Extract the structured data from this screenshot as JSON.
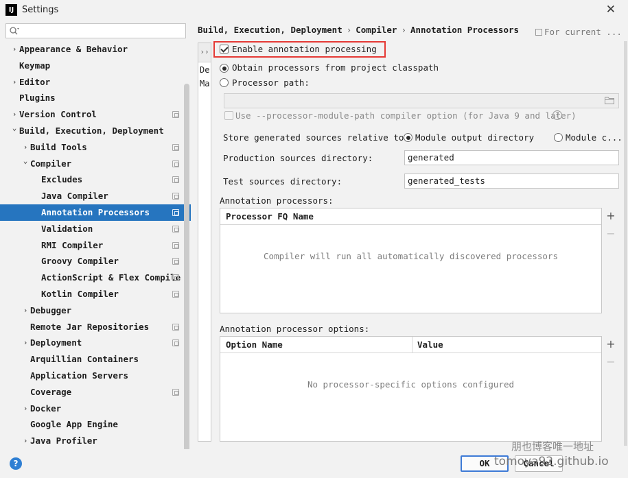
{
  "window": {
    "app_icon_text": "IJ",
    "title": "Settings"
  },
  "search": {
    "placeholder": ""
  },
  "sidebar": {
    "items": [
      {
        "label": "Appearance & Behavior",
        "level": 0,
        "chevron": "right",
        "proj": false,
        "selected": false
      },
      {
        "label": "Keymap",
        "level": 0,
        "chevron": "",
        "proj": false,
        "selected": false
      },
      {
        "label": "Editor",
        "level": 0,
        "chevron": "right",
        "proj": false,
        "selected": false
      },
      {
        "label": "Plugins",
        "level": 0,
        "chevron": "",
        "proj": false,
        "selected": false
      },
      {
        "label": "Version Control",
        "level": 0,
        "chevron": "right",
        "proj": true,
        "selected": false
      },
      {
        "label": "Build, Execution, Deployment",
        "level": 0,
        "chevron": "down",
        "proj": false,
        "selected": false
      },
      {
        "label": "Build Tools",
        "level": 1,
        "chevron": "right",
        "proj": true,
        "selected": false
      },
      {
        "label": "Compiler",
        "level": 1,
        "chevron": "down",
        "proj": true,
        "selected": false
      },
      {
        "label": "Excludes",
        "level": 2,
        "chevron": "",
        "proj": true,
        "selected": false
      },
      {
        "label": "Java Compiler",
        "level": 2,
        "chevron": "",
        "proj": true,
        "selected": false
      },
      {
        "label": "Annotation Processors",
        "level": 2,
        "chevron": "",
        "proj": true,
        "selected": true
      },
      {
        "label": "Validation",
        "level": 2,
        "chevron": "",
        "proj": true,
        "selected": false
      },
      {
        "label": "RMI Compiler",
        "level": 2,
        "chevron": "",
        "proj": true,
        "selected": false
      },
      {
        "label": "Groovy Compiler",
        "level": 2,
        "chevron": "",
        "proj": true,
        "selected": false
      },
      {
        "label": "ActionScript & Flex Compile",
        "level": 2,
        "chevron": "",
        "proj": true,
        "selected": false
      },
      {
        "label": "Kotlin Compiler",
        "level": 2,
        "chevron": "",
        "proj": true,
        "selected": false
      },
      {
        "label": "Debugger",
        "level": 1,
        "chevron": "right",
        "proj": false,
        "selected": false
      },
      {
        "label": "Remote Jar Repositories",
        "level": 1,
        "chevron": "",
        "proj": true,
        "selected": false
      },
      {
        "label": "Deployment",
        "level": 1,
        "chevron": "right",
        "proj": true,
        "selected": false
      },
      {
        "label": "Arquillian Containers",
        "level": 1,
        "chevron": "",
        "proj": false,
        "selected": false
      },
      {
        "label": "Application Servers",
        "level": 1,
        "chevron": "",
        "proj": false,
        "selected": false
      },
      {
        "label": "Coverage",
        "level": 1,
        "chevron": "",
        "proj": true,
        "selected": false
      },
      {
        "label": "Docker",
        "level": 1,
        "chevron": "right",
        "proj": false,
        "selected": false
      },
      {
        "label": "Google App Engine",
        "level": 1,
        "chevron": "",
        "proj": false,
        "selected": false
      },
      {
        "label": "Java Profiler",
        "level": 1,
        "chevron": "right",
        "proj": false,
        "selected": false
      }
    ]
  },
  "breadcrumb": {
    "parts": [
      "Build, Execution, Deployment",
      "Compiler",
      "Annotation Processors"
    ],
    "separator": "›",
    "for_current": "For current ..."
  },
  "profiles": {
    "collapse_glyph": "››",
    "rows": [
      "De",
      "Ma"
    ]
  },
  "form": {
    "enable_label": "Enable annotation processing",
    "enable_checked": true,
    "obtain_label": "Obtain processors from project classpath",
    "processor_path_label": "Processor path:",
    "processor_path_value": "",
    "module_path_label": "Use --processor-module-path compiler option (for Java 9 and later)",
    "help_glyph": "?",
    "store_label": "Store generated sources relative to:",
    "module_output_label": "Module output directory",
    "module_content_label": "Module c...",
    "production_label": "Production sources directory:",
    "production_value": "generated",
    "test_label": "Test sources directory:",
    "test_value": "generated_tests"
  },
  "processors_table": {
    "section_label": "Annotation processors:",
    "column": "Processor FQ Name",
    "empty_message": "Compiler will run all automatically discovered processors",
    "add": "+",
    "remove": "−"
  },
  "options_table": {
    "section_label": "Annotation processor options:",
    "columns": [
      "Option Name",
      "Value"
    ],
    "empty_message": "No processor-specific options configured",
    "add": "+",
    "remove": "−"
  },
  "buttons": {
    "help": "?",
    "ok": "OK",
    "cancel": "Cancel"
  },
  "watermark": {
    "line1": "朋也博客唯一地址",
    "line2": "tomoya92.github.io"
  },
  "colors": {
    "selection": "#2675bf",
    "highlight_box": "#e53935",
    "help_blue": "#2f7fd3"
  }
}
